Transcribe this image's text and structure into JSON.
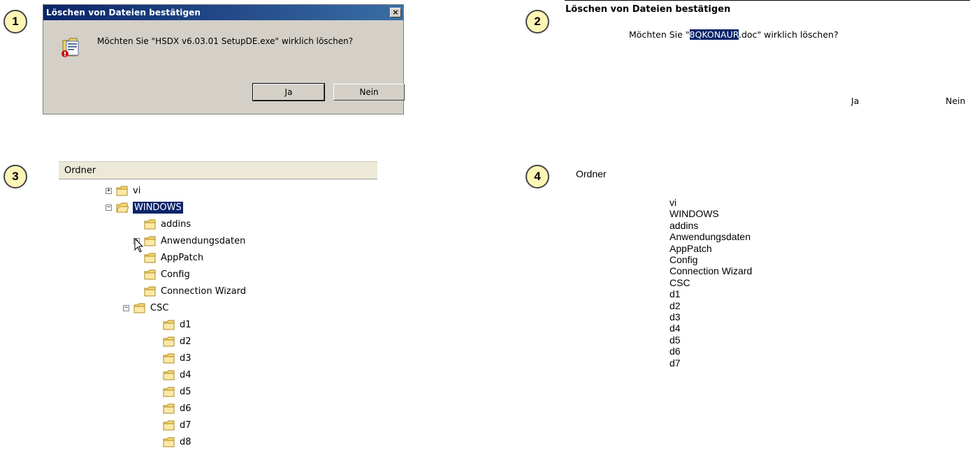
{
  "badges": [
    "1",
    "2",
    "3",
    "4"
  ],
  "panel1": {
    "title": "Löschen von Dateien bestätigen",
    "close": "×",
    "message": "Möchten Sie \"HSDX v6.03.01 SetupDE.exe\" wirklich löschen?",
    "yes": "Ja",
    "no": "Nein"
  },
  "panel2": {
    "title": "Löschen von Dateien bestätigen",
    "message_before": "Möchten Sie \"",
    "message_selected": "8QKONAUR",
    "message_after": ".doc\" wirklich löschen?",
    "yes": "Ja",
    "no": "Nein"
  },
  "panel3": {
    "header": "Ordner",
    "nodes": [
      "vi",
      "WINDOWS",
      "addins",
      "Anwendungsdaten",
      "AppPatch",
      "Config",
      "Connection Wizard",
      "CSC",
      "d1",
      "d2",
      "d3",
      "d4",
      "d5",
      "d6",
      "d7",
      "d8"
    ],
    "expanders": {
      "collapsed": "+",
      "expanded": "−"
    },
    "selected": "WINDOWS",
    "selection_color": "#0a246a",
    "folder_icon": "folder-icon"
  },
  "panel4": {
    "header": "Ordner",
    "items": [
      "vi",
      "WINDOWS",
      "addins",
      "Anwendungsdaten",
      "AppPatch",
      "Config",
      "Connection Wizard",
      "CSC",
      "d1",
      "d2",
      "d3",
      "d4",
      "d5",
      "d6",
      "d7"
    ]
  }
}
